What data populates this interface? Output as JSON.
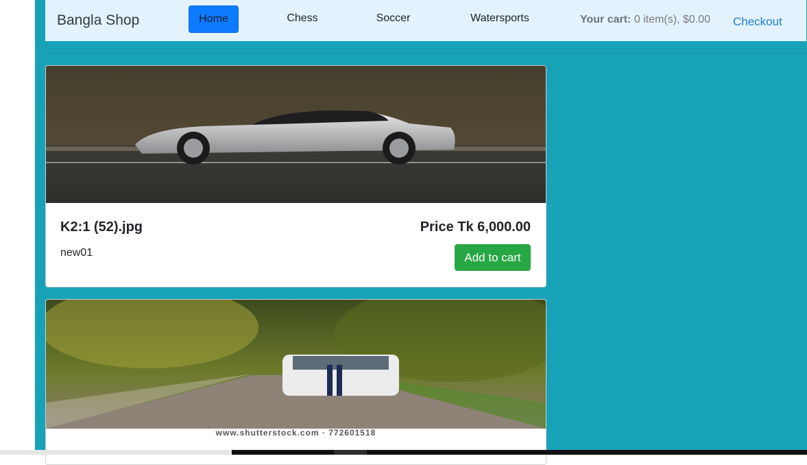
{
  "navbar": {
    "brand": "Bangla Shop",
    "links": [
      {
        "label": "Home"
      },
      {
        "label": "Chess"
      },
      {
        "label": "Soccer"
      },
      {
        "label": "Watersports"
      }
    ],
    "cart": {
      "label": "Your cart:",
      "summary": "0 item(s), $0.00"
    },
    "checkout": "Checkout"
  },
  "products": [
    {
      "title": "K2:1 (52).jpg",
      "price": "Price Tk 6,000.00",
      "description": "new01",
      "add_label": "Add to cart"
    },
    {
      "watermark_caption": "www.shutterstock.com · 772601518"
    }
  ],
  "colors": {
    "page_bg": "#18a2b8",
    "navbar_bg": "#e3f2fd",
    "active_nav": "#0d7bff",
    "add_button": "#28a745",
    "checkout_link": "#1e7fd6"
  },
  "icons": [
    "car-photo",
    "road-photo"
  ]
}
